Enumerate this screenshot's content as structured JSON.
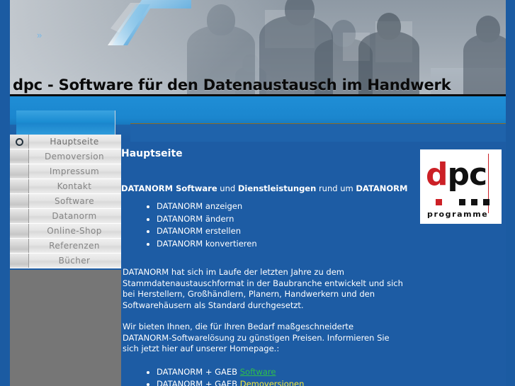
{
  "header": {
    "title": "dpc - Software für den Datenaustausch im Handwerk",
    "chevron_icon": "double-chevron-right"
  },
  "sidebar": {
    "items": [
      {
        "label": "Hauptseite",
        "active": true
      },
      {
        "label": "Demoversion",
        "active": false
      },
      {
        "label": "Impressum",
        "active": false
      },
      {
        "label": "Kontakt",
        "active": false
      },
      {
        "label": "Software",
        "active": false
      },
      {
        "label": "Datanorm",
        "active": false
      },
      {
        "label": "Online-Shop",
        "active": false
      },
      {
        "label": "Referenzen",
        "active": false
      },
      {
        "label": "Bücher",
        "active": false
      }
    ]
  },
  "content": {
    "page_title": "Hauptseite",
    "lead": {
      "part1": "DATANORM Software",
      "part2": " und ",
      "part3": "Dienstleistungen",
      "part4": " rund um ",
      "part5": "DATANORM"
    },
    "features": [
      "DATANORM anzeigen",
      "DATANORM ändern",
      "DATANORM erstellen",
      "DATANORM konvertieren"
    ],
    "paragraph1": "DATANORM hat sich im Laufe der letzten Jahre zu dem Stammdatenaustauschformat in der Baubranche entwickelt und sich bei Herstellern, Großhändlern, Planern, Handwerkern und den Softwarehäusern als Standard durchgesetzt.",
    "paragraph2": "Wir bieten Ihnen, die für Ihren Bedarf maßgeschneiderte DATANORM-Softwarelösung zu günstigen Preisen. Informieren Sie sich jetzt hier auf unserer Homepage.:",
    "links": [
      {
        "prefix": "DATANORM + GAEB ",
        "link": "Software",
        "style": "green"
      },
      {
        "prefix": "DATANORM + GAEB ",
        "link": "Demoversionen",
        "style": "yellow"
      }
    ]
  },
  "logo": {
    "letter_d": "d",
    "letters_pc": "pc",
    "tagline": "programme"
  },
  "colors": {
    "frame_blue": "#1b5ba2",
    "content_blue": "#1d5ca4",
    "band_blue": "#1f8ed6",
    "gray_fill": "#767676",
    "link_green": "#2fbf4a",
    "link_yellow": "#f2e73b",
    "logo_red": "#cc2026"
  }
}
